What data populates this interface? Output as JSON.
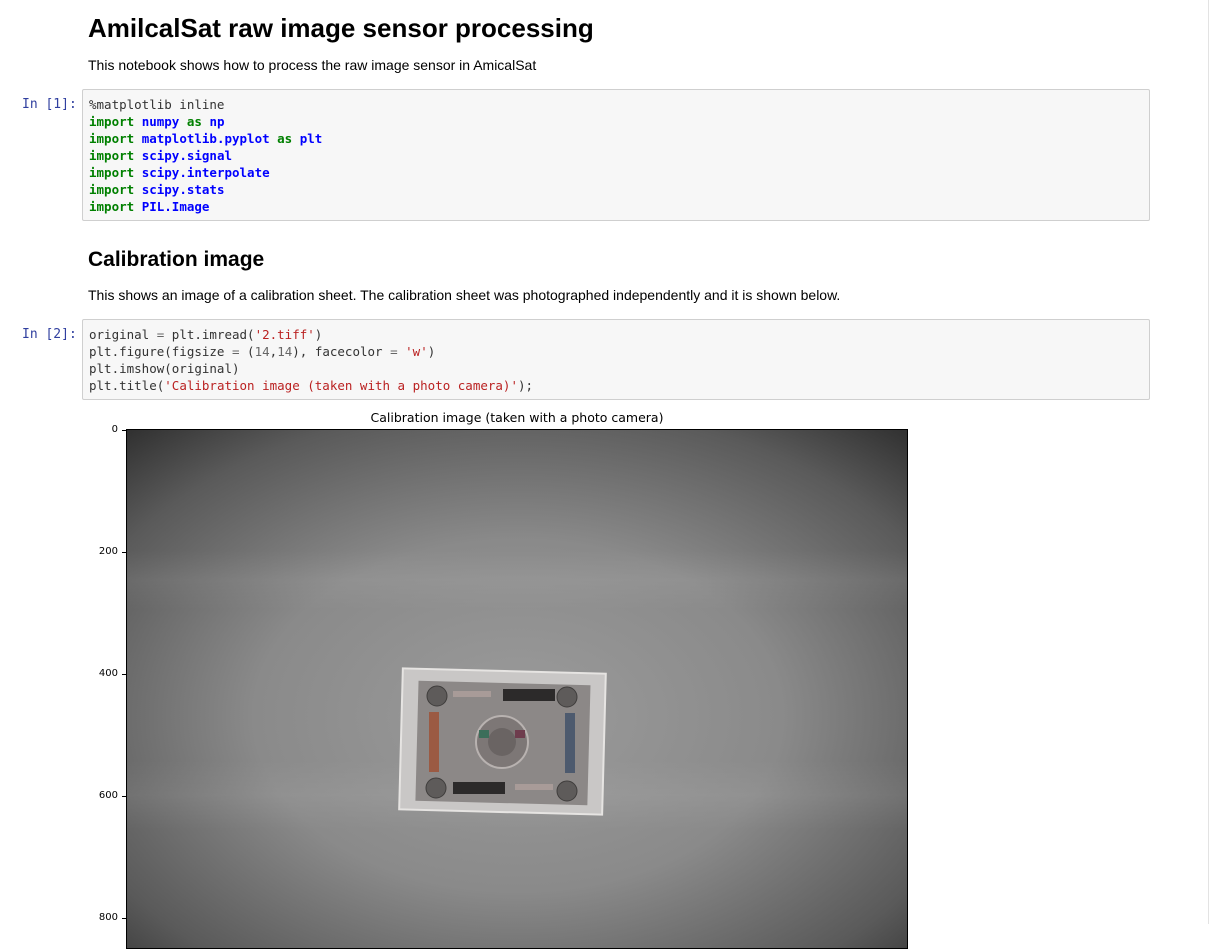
{
  "notebook": {
    "title": "AmilcalSat raw image sensor processing",
    "intro": "This notebook shows how to process the raw image sensor in AmicalSat",
    "section_heading": "Calibration image",
    "section_text": "This shows an image of a calibration sheet. The calibration sheet was photographed independently and it is shown below."
  },
  "cells": [
    {
      "prompt": "In [1]:",
      "lines": [
        [
          [
            "mg",
            "%matplotlib inline"
          ]
        ],
        [
          [
            "kw",
            "import"
          ],
          [
            "tx",
            " "
          ],
          [
            "nm",
            "numpy"
          ],
          [
            "tx",
            " "
          ],
          [
            "kw",
            "as"
          ],
          [
            "tx",
            " "
          ],
          [
            "nm",
            "np"
          ]
        ],
        [
          [
            "kw",
            "import"
          ],
          [
            "tx",
            " "
          ],
          [
            "nm",
            "matplotlib.pyplot"
          ],
          [
            "tx",
            " "
          ],
          [
            "kw",
            "as"
          ],
          [
            "tx",
            " "
          ],
          [
            "nm",
            "plt"
          ]
        ],
        [
          [
            "kw",
            "import"
          ],
          [
            "tx",
            " "
          ],
          [
            "nm",
            "scipy.signal"
          ]
        ],
        [
          [
            "kw",
            "import"
          ],
          [
            "tx",
            " "
          ],
          [
            "nm",
            "scipy.interpolate"
          ]
        ],
        [
          [
            "kw",
            "import"
          ],
          [
            "tx",
            " "
          ],
          [
            "nm",
            "scipy.stats"
          ]
        ],
        [
          [
            "kw",
            "import"
          ],
          [
            "tx",
            " "
          ],
          [
            "nm",
            "PIL.Image"
          ]
        ]
      ]
    },
    {
      "prompt": "In [2]:",
      "lines": [
        [
          [
            "tx",
            "original "
          ],
          [
            "op",
            "="
          ],
          [
            "tx",
            " plt.imread("
          ],
          [
            "st",
            "'2.tiff'"
          ],
          [
            "tx",
            ")"
          ]
        ],
        [
          [
            "tx",
            "plt.figure(figsize "
          ],
          [
            "op",
            "="
          ],
          [
            "tx",
            " ("
          ],
          [
            "nu",
            "14"
          ],
          [
            "tx",
            ","
          ],
          [
            "nu",
            "14"
          ],
          [
            "tx",
            "), facecolor "
          ],
          [
            "op",
            "="
          ],
          [
            "tx",
            " "
          ],
          [
            "st",
            "'w'"
          ],
          [
            "tx",
            ")"
          ]
        ],
        [
          [
            "tx",
            "plt.imshow(original)"
          ]
        ],
        [
          [
            "tx",
            "plt.title("
          ],
          [
            "st",
            "'Calibration image (taken with a photo camera)'"
          ],
          [
            "tx",
            ");"
          ]
        ]
      ]
    }
  ],
  "output_plot": {
    "title": "Calibration image (taken with a photo camera)",
    "y_ticks": [
      "0",
      "200",
      "400",
      "600",
      "800"
    ],
    "image_description_icon": "calibration-target-image"
  }
}
